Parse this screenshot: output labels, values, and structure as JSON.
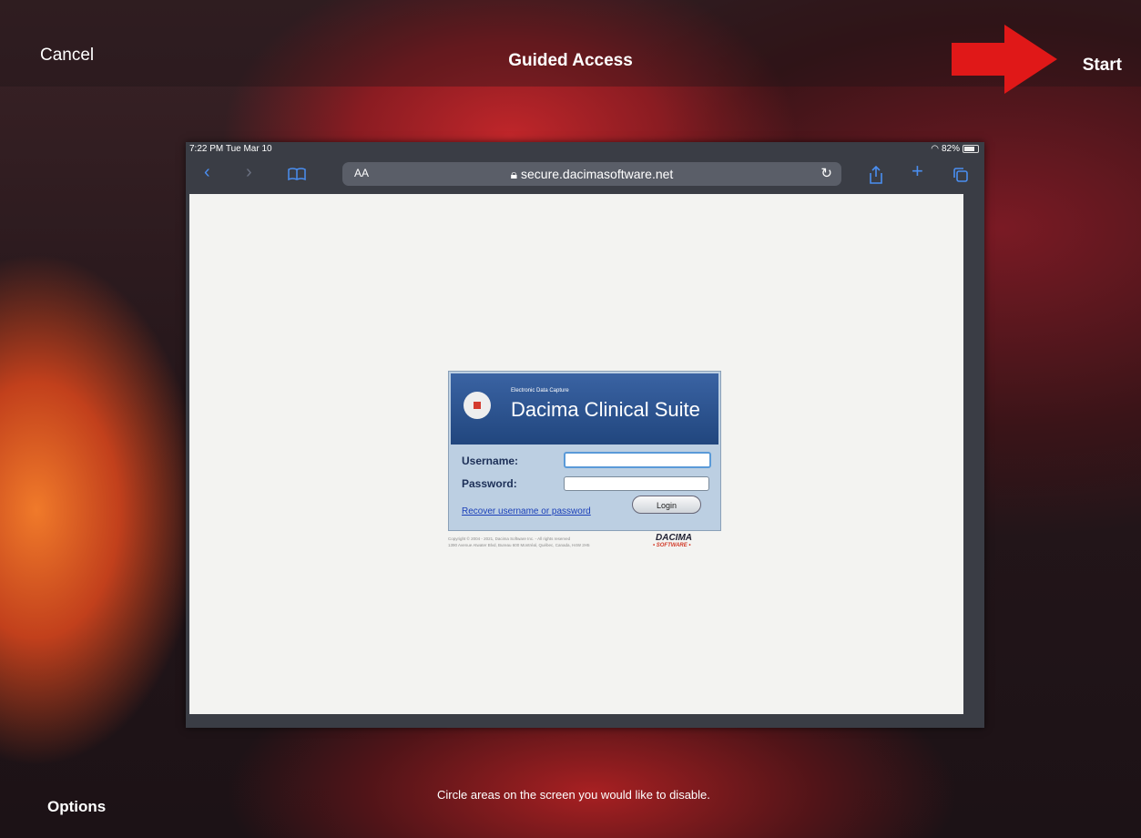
{
  "guided_access": {
    "cancel_label": "Cancel",
    "title": "Guided Access",
    "start_label": "Start",
    "options_label": "Options",
    "hint": "Circle areas on the screen you would like to disable."
  },
  "annotation": {
    "arrow_color": "#e01818",
    "arrow_icon": "right-arrow"
  },
  "ipad": {
    "status": {
      "time": "7:22 PM  Tue Mar 10",
      "battery": "82%"
    },
    "toolbar": {
      "back_icon": "chevron-left",
      "forward_icon": "chevron-right",
      "bookmarks_icon": "book",
      "text_size_label": "AA",
      "url": "secure.dacimasoftware.net",
      "reload_icon": "reload",
      "share_icon": "share",
      "new_tab_icon": "plus",
      "tabs_icon": "tabs"
    },
    "login": {
      "tagline": "Electronic Data Capture",
      "app_name": "Dacima Clinical Suite",
      "username_label": "Username:",
      "username_value": "",
      "password_label": "Password:",
      "password_value": "",
      "recover_link": "Recover username or password",
      "login_button": "Login",
      "copyright_line1": "Copyright © 2004 - 2021, Dacima Software Inc. - All rights reserved",
      "copyright_line2": "1390 Avenue Atwater Blvd, Bureau 600 Montréal, Québec, Canada, H4W 2H5",
      "brand": "DACIMA",
      "brand_sub": "• SOFTWARE •"
    }
  }
}
